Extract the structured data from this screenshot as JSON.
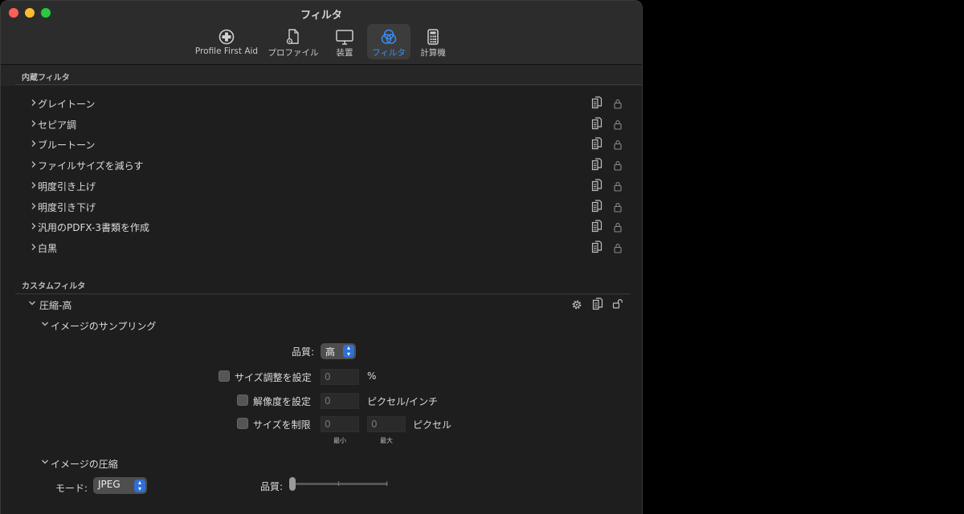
{
  "window": {
    "title": "フィルタ"
  },
  "toolbar": {
    "tabs": [
      {
        "label": "Profile First Aid",
        "icon": "first-aid-icon"
      },
      {
        "label": "プロファイル",
        "icon": "profile-document-icon"
      },
      {
        "label": "装置",
        "icon": "monitor-icon"
      },
      {
        "label": "フィルタ",
        "icon": "color-filter-icon",
        "active": true
      },
      {
        "label": "計算機",
        "icon": "calculator-icon"
      }
    ],
    "accent_color": "#3b8cf5"
  },
  "builtin": {
    "header": "内蔵フィルタ",
    "items": [
      {
        "label": "グレイトーン"
      },
      {
        "label": "セピア調"
      },
      {
        "label": "ブルートーン"
      },
      {
        "label": "ファイルサイズを減らす"
      },
      {
        "label": "明度引き上げ"
      },
      {
        "label": "明度引き下げ"
      },
      {
        "label": "汎用のPDFX-3書類を作成"
      },
      {
        "label": "白黒"
      }
    ]
  },
  "custom": {
    "header": "カスタムフィルタ",
    "filter_name": "圧縮-高",
    "sampling": {
      "title": "イメージのサンプリング",
      "quality_label": "品質:",
      "quality_value": "高",
      "resize_label": "サイズ調整を設定",
      "resize_value": "",
      "resize_placeholder": "0",
      "resize_unit": "%",
      "resolution_label": "解像度を設定",
      "resolution_value": "",
      "resolution_placeholder": "0",
      "resolution_unit": "ピクセル/インチ",
      "limit_label": "サイズを制限",
      "limit_min_placeholder": "0",
      "limit_max_placeholder": "0",
      "limit_unit": "ピクセル",
      "min_label": "最小",
      "max_label": "最大"
    },
    "compression": {
      "title": "イメージの圧縮",
      "mode_label": "モード:",
      "mode_value": "JPEG",
      "quality_label": "品質:",
      "quality_slider_fraction": 0.0
    }
  }
}
